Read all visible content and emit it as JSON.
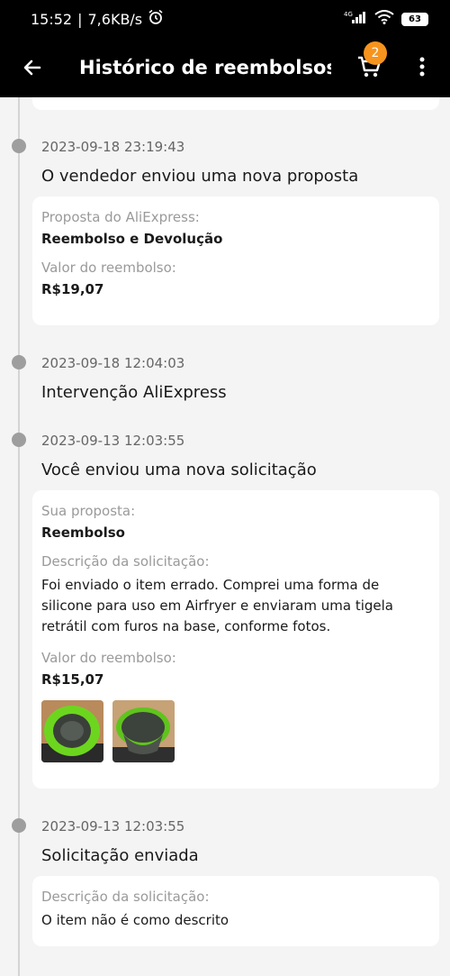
{
  "status_bar": {
    "time": "15:52",
    "speed": "7,6KB/s",
    "network": "4G",
    "battery": "63"
  },
  "app_bar": {
    "title": "Histórico de reembolsos...",
    "cart_count": "2",
    "accent_color": "#f7941d"
  },
  "entries": [
    {
      "date": "2023-09-18 23:19:43",
      "title": "O vendedor enviou uma nova proposta",
      "fields": [
        {
          "label": "Proposta do AliExpress:",
          "value": "Reembolso e Devolução"
        },
        {
          "label": "Valor do reembolso:",
          "value": "R$19,07"
        }
      ]
    },
    {
      "date": "2023-09-18 12:04:03",
      "title": "Intervenção AliExpress"
    },
    {
      "date": "2023-09-13 12:03:55",
      "title": "Você enviou uma nova solicitação",
      "fields": [
        {
          "label": "Sua proposta:",
          "value": "Reembolso"
        },
        {
          "label": "Descrição da solicitação:",
          "value": "Foi enviado o item errado. Comprei uma forma de silicone para uso em Airfryer e enviaram uma tigela retrátil com furos na base, conforme fotos."
        },
        {
          "label": "Valor do reembolso:",
          "value": "R$15,07"
        }
      ],
      "photos": [
        "photo-green-colander-top",
        "photo-green-colander-side"
      ]
    },
    {
      "date": "2023-09-13 12:03:55",
      "title": "Solicitação enviada",
      "fields": [
        {
          "label": "Descrição da solicitação:",
          "value": "O item não é como descrito"
        }
      ]
    }
  ]
}
